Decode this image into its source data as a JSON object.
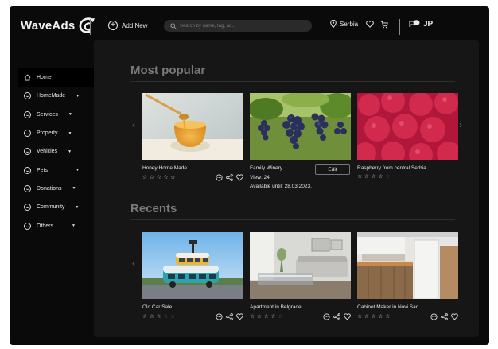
{
  "header": {
    "logo_text": "WaveAds",
    "add_new_label": "Add New",
    "search_placeholder": "Search by name, tag, ad...",
    "location": "Serbia",
    "user_initials": "JP"
  },
  "sidebar": {
    "items": [
      {
        "label": "Home",
        "icon": "home-icon",
        "has_submenu": false,
        "active": true
      },
      {
        "label": "HomeMade",
        "icon": "category-icon",
        "has_submenu": true
      },
      {
        "label": "Services",
        "icon": "category-icon",
        "has_submenu": true
      },
      {
        "label": "Property",
        "icon": "category-icon",
        "has_submenu": true
      },
      {
        "label": "Vehicles",
        "icon": "category-icon",
        "has_submenu": true
      },
      {
        "label": "Pets",
        "icon": "category-icon",
        "has_submenu": true
      },
      {
        "label": "Donations",
        "icon": "category-icon",
        "has_submenu": true
      },
      {
        "label": "Community",
        "icon": "category-icon",
        "has_submenu": true
      },
      {
        "label": "Others",
        "icon": "category-icon",
        "has_submenu": true
      }
    ]
  },
  "main": {
    "popular_title": "Most popular",
    "recents_title": "Recents",
    "popular": [
      {
        "title": "Honey Home Made",
        "image": "honey",
        "rating": 5
      },
      {
        "title": "Family Winery",
        "image": "grapes",
        "edit_label": "Edit",
        "views": "View: 24",
        "available": "Available until:  28.03.2023."
      },
      {
        "title": "Raspberry from central Serbia",
        "image": "raspberry",
        "rating": 4
      }
    ],
    "recents": [
      {
        "title": "Old Car Sale",
        "image": "vans",
        "rating": 3
      },
      {
        "title": "Apartment in Belgrade",
        "image": "apartment",
        "rating": 4
      },
      {
        "title": "Cabinet Maker in Novi Sad",
        "image": "kitchen",
        "rating": 5
      }
    ]
  },
  "colors": {
    "background": "#0a0a0a",
    "panel": "#161616",
    "muted_heading": "#7a7a7a"
  }
}
